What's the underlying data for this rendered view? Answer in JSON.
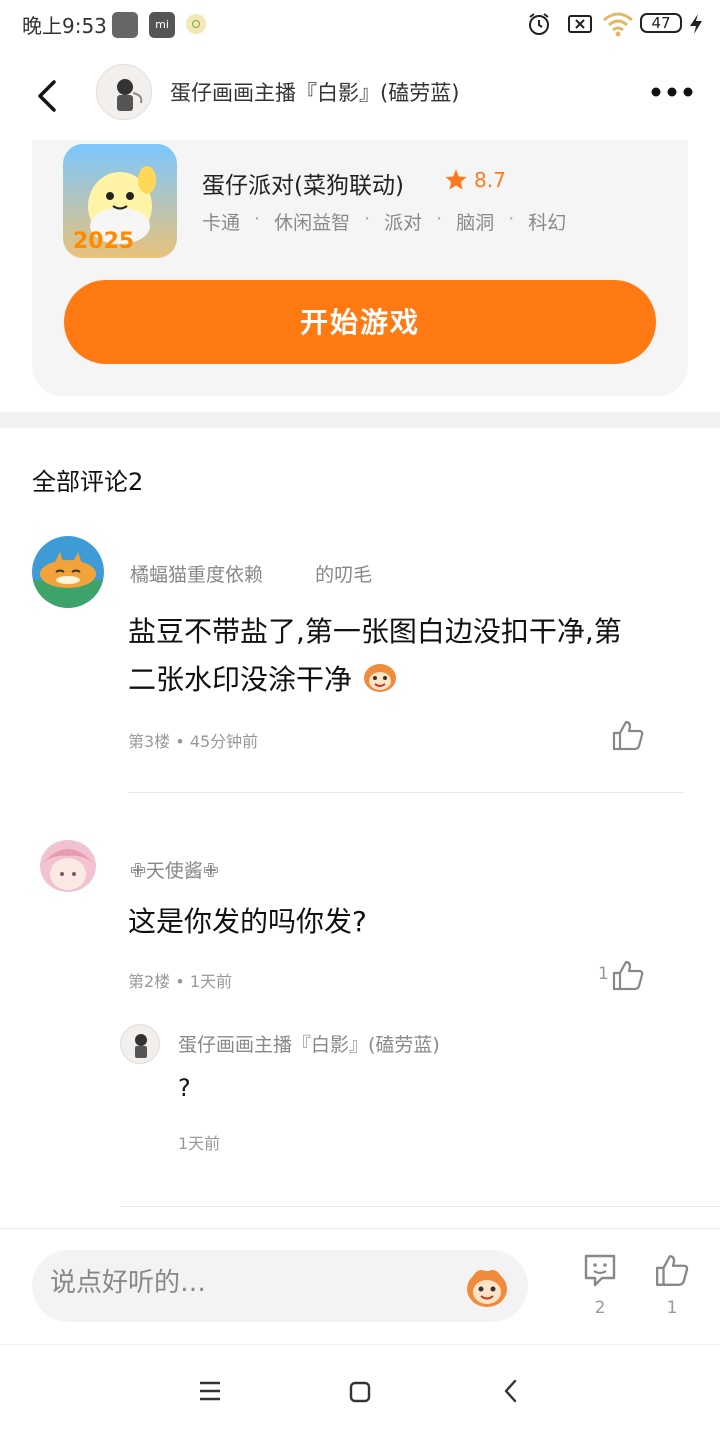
{
  "status_bar": {
    "time": "晚上9:53",
    "battery": "47"
  },
  "header": {
    "title": "蛋仔画画主播『白影』(磕劳蓝)"
  },
  "game": {
    "name": "蛋仔派对(菜狗联动)",
    "rating": "8.7",
    "tags": [
      "卡通",
      "休闲益智",
      "派对",
      "脑洞",
      "科幻"
    ],
    "play_label": "开始游戏",
    "accent_color": "#ff7a13"
  },
  "comments": {
    "title": "全部评论2",
    "items": [
      {
        "user": "橘蝠猫重度依赖",
        "suffix": "的叨毛",
        "text": "盐豆不带盐了,第一张图白边没扣干净,第二张水印没涂干净",
        "floor": "第3楼",
        "time": "45分钟前",
        "likes": ""
      },
      {
        "user": "✙天使酱✙",
        "text": "这是你发的吗你发?",
        "floor": "第2楼",
        "time": "1天前",
        "likes": "1",
        "reply": {
          "user": "蛋仔画画主播『白影』(磕劳蓝)",
          "text": "?",
          "time": "1天前"
        }
      }
    ]
  },
  "bottom_bar": {
    "input_placeholder": "说点好听的…",
    "comment_count": "2",
    "like_count": "1"
  },
  "icons": [
    "back-icon",
    "more-icon",
    "star-icon",
    "like-icon",
    "comment-icon",
    "emoji-icon",
    "menu-icon",
    "home-icon",
    "nav-back-icon"
  ]
}
